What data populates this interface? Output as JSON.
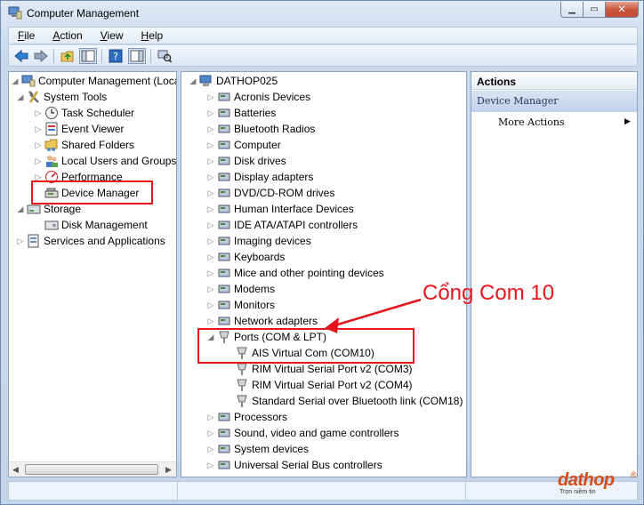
{
  "window": {
    "title": "Computer Management"
  },
  "menu": [
    "File",
    "Action",
    "View",
    "Help"
  ],
  "left_tree": {
    "root": "Computer Management (Local",
    "items": [
      {
        "label": "System Tools",
        "level": 1,
        "expanded": true
      },
      {
        "label": "Task Scheduler",
        "level": 2
      },
      {
        "label": "Event Viewer",
        "level": 2
      },
      {
        "label": "Shared Folders",
        "level": 2
      },
      {
        "label": "Local Users and Groups",
        "level": 2
      },
      {
        "label": "Performance",
        "level": 2
      },
      {
        "label": "Device Manager",
        "level": 2,
        "selected": true
      },
      {
        "label": "Storage",
        "level": 1,
        "expanded": true
      },
      {
        "label": "Disk Management",
        "level": 2
      },
      {
        "label": "Services and Applications",
        "level": 1
      }
    ]
  },
  "device_tree": {
    "computer": "DATHOP025",
    "categories": [
      "Acronis Devices",
      "Batteries",
      "Bluetooth Radios",
      "Computer",
      "Disk drives",
      "Display adapters",
      "DVD/CD-ROM drives",
      "Human Interface Devices",
      "IDE ATA/ATAPI controllers",
      "Imaging devices",
      "Keyboards",
      "Mice and other pointing devices",
      "Modems",
      "Monitors",
      "Network adapters"
    ],
    "ports": {
      "label": "Ports (COM & LPT)",
      "children": [
        "AIS Virtual Com (COM10)",
        "RIM Virtual Serial Port v2 (COM3)",
        "RIM Virtual Serial Port v2 (COM4)",
        "Standard Serial over Bluetooth link (COM18)"
      ]
    },
    "after": [
      "Processors",
      "Sound, video and game controllers",
      "System devices",
      "Universal Serial Bus controllers"
    ]
  },
  "actions": {
    "header": "Actions",
    "section": "Device Manager",
    "more": "More Actions"
  },
  "annotation": {
    "text": "Cổng Com 10",
    "color": "#e8141b"
  },
  "watermark": {
    "brand": "dathop",
    "mark": "®",
    "tagline": "Trọn niềm tin"
  }
}
